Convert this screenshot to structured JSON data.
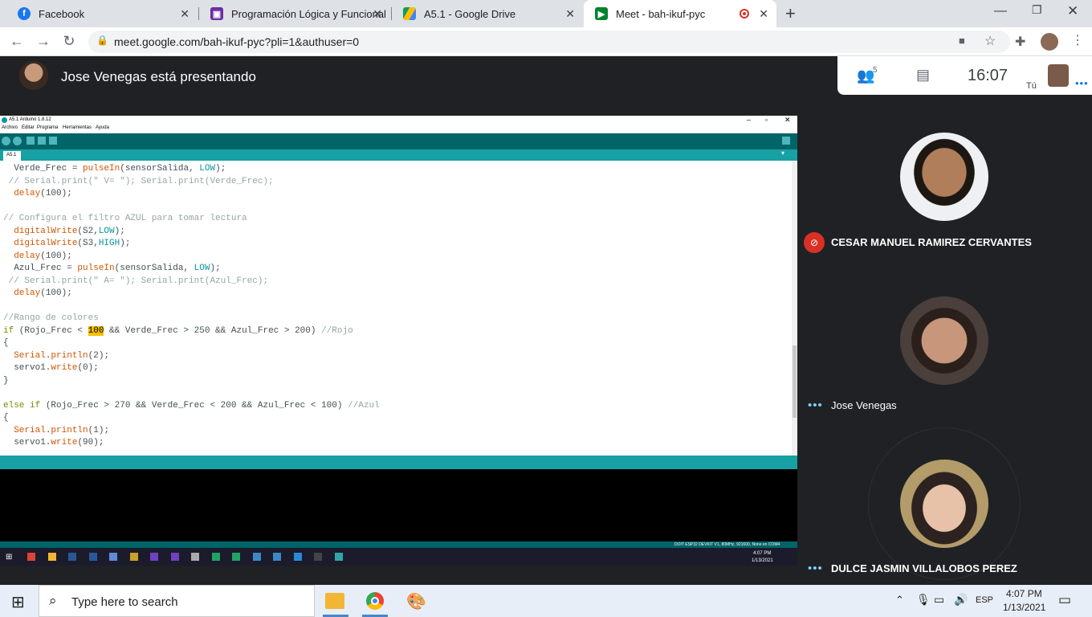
{
  "browser": {
    "tabs": [
      {
        "title": "Facebook",
        "icon": "facebook-icon",
        "color": "#1877f2"
      },
      {
        "title": "Programación Lógica y Funcional",
        "icon": "classroom-icon",
        "color": "#6c2ea3"
      },
      {
        "title": "A5.1 - Google Drive",
        "icon": "drive-icon",
        "color": "#fbbc04"
      },
      {
        "title": "Meet - bah-ikuf-pyc",
        "icon": "meet-icon",
        "color": "#00832d"
      }
    ],
    "new_tab": "+",
    "url": "meet.google.com/bah-ikuf-pyc?pli=1&authuser=0"
  },
  "meet": {
    "presenting": "Jose Venegas está presentando",
    "participants_count": "5",
    "time": "16:07",
    "you_label": "Tú"
  },
  "arduino": {
    "title": "A5.1 Arduino 1.8.12",
    "menu": [
      "Archivo",
      "Editar",
      "Programa",
      "Herramientas",
      "Ayuda"
    ],
    "tab": "A5.1",
    "status_bottom": "DOIT ESP32 DEVKIT V1, 80MHz, 921600, None en COM4",
    "inner_time": "4:07 PM",
    "inner_date": "1/13/2021"
  },
  "code_lines": [
    {
      "segs": [
        [
          "  Verde_Frec = ",
          ""
        ],
        [
          "pulseIn",
          "kw"
        ],
        [
          "(sensorSalida, ",
          ""
        ],
        [
          "LOW",
          "cn"
        ],
        [
          ");",
          ""
        ]
      ]
    },
    {
      "segs": [
        [
          " // Serial.print(\" V= \"); Serial.print(Verde_Frec);",
          "cm"
        ]
      ]
    },
    {
      "segs": [
        [
          "  ",
          ""
        ],
        [
          "delay",
          "kw"
        ],
        [
          "(100);",
          ""
        ]
      ]
    },
    {
      "segs": [
        [
          "",
          ""
        ]
      ]
    },
    {
      "segs": [
        [
          "// Configura el filtro AZUL para tomar lectura",
          "cm"
        ]
      ]
    },
    {
      "segs": [
        [
          "  ",
          ""
        ],
        [
          "digitalWrite",
          "kw"
        ],
        [
          "(S2,",
          ""
        ],
        [
          "LOW",
          "cn"
        ],
        [
          ");",
          ""
        ]
      ]
    },
    {
      "segs": [
        [
          "  ",
          ""
        ],
        [
          "digitalWrite",
          "kw"
        ],
        [
          "(S3,",
          ""
        ],
        [
          "HIGH",
          "cn"
        ],
        [
          ");",
          ""
        ]
      ]
    },
    {
      "segs": [
        [
          "  ",
          ""
        ],
        [
          "delay",
          "kw"
        ],
        [
          "(100);",
          ""
        ]
      ]
    },
    {
      "segs": [
        [
          "  Azul_Frec = ",
          ""
        ],
        [
          "pulseIn",
          "kw"
        ],
        [
          "(sensorSalida, ",
          ""
        ],
        [
          "LOW",
          "cn"
        ],
        [
          ");",
          ""
        ]
      ]
    },
    {
      "segs": [
        [
          " // Serial.print(\" A= \"); Serial.print(Azul_Frec);",
          "cm"
        ]
      ]
    },
    {
      "segs": [
        [
          "  ",
          ""
        ],
        [
          "delay",
          "kw"
        ],
        [
          "(100);",
          ""
        ]
      ]
    },
    {
      "segs": [
        [
          "",
          ""
        ]
      ]
    },
    {
      "segs": [
        [
          "//Rango de colores",
          "cm"
        ]
      ]
    },
    {
      "segs": [
        [
          "if",
          "kb"
        ],
        [
          " (Rojo_Frec < ",
          ""
        ],
        [
          "100",
          "hl"
        ],
        [
          " && Verde_Frec > 250 && Azul_Frec > 200) ",
          ""
        ],
        [
          "//Rojo",
          "cm"
        ]
      ]
    },
    {
      "segs": [
        [
          "{",
          ""
        ]
      ]
    },
    {
      "segs": [
        [
          "  ",
          ""
        ],
        [
          "Serial",
          "kw"
        ],
        [
          ".",
          ""
        ],
        [
          "println",
          "kw"
        ],
        [
          "(2);",
          ""
        ]
      ]
    },
    {
      "segs": [
        [
          "  servo1.",
          ""
        ],
        [
          "write",
          "kw"
        ],
        [
          "(0);",
          ""
        ]
      ]
    },
    {
      "segs": [
        [
          "}",
          ""
        ]
      ]
    },
    {
      "segs": [
        [
          "",
          ""
        ]
      ]
    },
    {
      "segs": [
        [
          "else if",
          "kb"
        ],
        [
          " (Rojo_Frec > 270 && Verde_Frec < 200 && Azul_Frec < 100) ",
          ""
        ],
        [
          "//Azul",
          "cm"
        ]
      ]
    },
    {
      "segs": [
        [
          "{",
          ""
        ]
      ]
    },
    {
      "segs": [
        [
          "  ",
          ""
        ],
        [
          "Serial",
          "kw"
        ],
        [
          ".",
          ""
        ],
        [
          "println",
          "kw"
        ],
        [
          "(1);",
          ""
        ]
      ]
    },
    {
      "segs": [
        [
          "  servo1.",
          ""
        ],
        [
          "write",
          "kw"
        ],
        [
          "(90);",
          ""
        ]
      ]
    }
  ],
  "participants": [
    {
      "name": "CESAR MANUEL RAMIREZ CERVANTES",
      "muted": true
    },
    {
      "name": "Jose Venegas",
      "muted": false
    },
    {
      "name": "DULCE JASMIN VILLALOBOS PEREZ",
      "muted": false
    }
  ],
  "taskbar": {
    "search_placeholder": "Type here to search",
    "lang": "ESP",
    "time": "4:07 PM",
    "date": "1/13/2021"
  }
}
